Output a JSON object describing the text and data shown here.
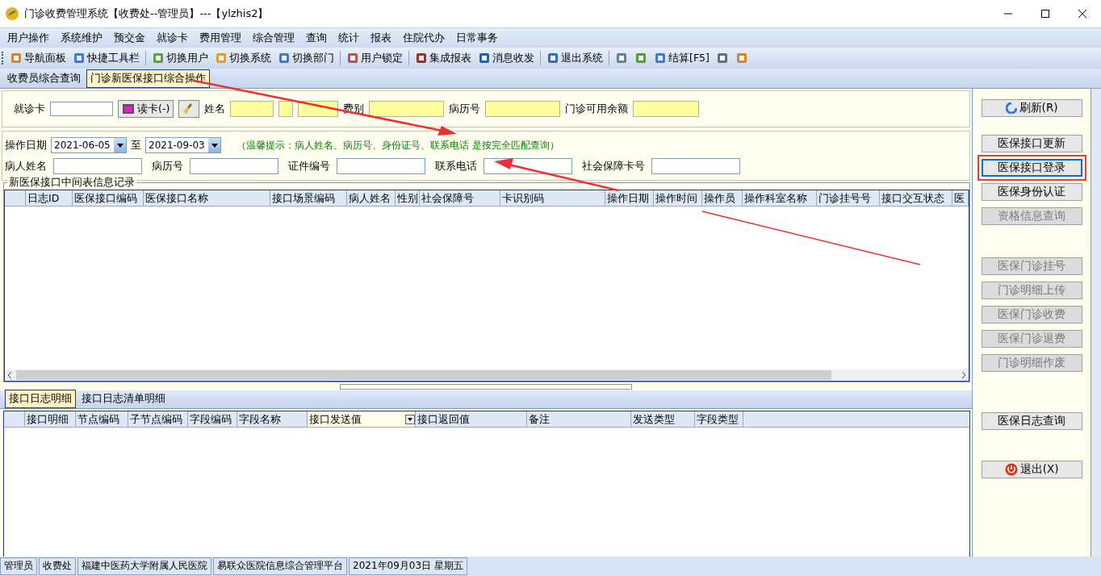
{
  "window": {
    "title": "门诊收费管理系统【收费处--管理员】---【ylzhis2】"
  },
  "menu": [
    "用户操作",
    "系统维护",
    "预交金",
    "就诊卡",
    "费用管理",
    "综合管理",
    "查询",
    "统计",
    "报表",
    "住院代办",
    "日常事务"
  ],
  "toolbar": [
    {
      "kind": "labeled",
      "label": "导航面板"
    },
    {
      "kind": "labeled",
      "label": "快捷工具栏"
    },
    {
      "kind": "separator"
    },
    {
      "kind": "labeled",
      "label": "切换用户"
    },
    {
      "kind": "labeled",
      "label": "切换系统"
    },
    {
      "kind": "labeled",
      "label": "切换部门"
    },
    {
      "kind": "separator"
    },
    {
      "kind": "labeled",
      "label": "用户锁定"
    },
    {
      "kind": "separator"
    },
    {
      "kind": "labeled",
      "label": "集成报表"
    },
    {
      "kind": "labeled",
      "label": "消息收发"
    },
    {
      "kind": "separator"
    },
    {
      "kind": "labeled",
      "label": "退出系统"
    },
    {
      "kind": "separator"
    },
    {
      "kind": "icon"
    },
    {
      "kind": "icon"
    },
    {
      "kind": "labeled",
      "label": "结算[F5]"
    },
    {
      "kind": "icon"
    },
    {
      "kind": "icon"
    }
  ],
  "tabs": [
    {
      "label": "收费员综合查询",
      "selected": false
    },
    {
      "label": "门诊新医保接口综合操作",
      "selected": true
    }
  ],
  "card_panel": {
    "card_label": "就诊卡",
    "read_button": "读卡(-)",
    "fields": [
      {
        "label": "姓名",
        "kind": "split"
      },
      {
        "label": "费别",
        "kind": "single"
      },
      {
        "label": "病历号",
        "kind": "single"
      },
      {
        "label": "门诊可用余额",
        "kind": "short"
      }
    ]
  },
  "filter": {
    "date_label": "操作日期",
    "date_from": "2021-06-05",
    "to_label": "至",
    "date_to": "2021-09-03",
    "hint": "（温馨提示：病人姓名、病历号、身份证号、联系电话 是按完全匹配查询）",
    "fields": [
      "病人姓名",
      "病历号",
      "证件编号",
      "联系电话",
      "社会保障卡号"
    ]
  },
  "log_group": {
    "title": "新医保接口中间表信息记录",
    "columns": [
      "日志ID",
      "医保接口编码",
      "医保接口名称",
      "接口场景编码",
      "病人姓名",
      "性别",
      "社会保障号",
      "卡识别码",
      "操作日期",
      "操作时间",
      "操作员",
      "操作科室名称",
      "门诊挂号号",
      "接口交互状态",
      "医"
    ]
  },
  "detail_tabs": [
    {
      "label": "接口日志明细",
      "selected": true
    },
    {
      "label": "接口日志清单明细",
      "selected": false
    }
  ],
  "detail_columns": [
    {
      "label": "接口明细",
      "kind": "plain"
    },
    {
      "label": "节点编码",
      "kind": "plain"
    },
    {
      "label": "子节点编码",
      "kind": "plain"
    },
    {
      "label": "字段编码",
      "kind": "plain"
    },
    {
      "label": "字段名称",
      "kind": "plain"
    },
    {
      "label": "接口发送值",
      "kind": "dropdown"
    },
    {
      "label": "接口返回值",
      "kind": "plain"
    },
    {
      "label": "备注",
      "kind": "plain"
    },
    {
      "label": "发送类型",
      "kind": "plain"
    },
    {
      "label": "字段类型",
      "kind": "plain"
    }
  ],
  "side_groups": [
    {
      "buttons": [
        {
          "label": "刷新(R)",
          "kind": "refresh",
          "disabled": false,
          "highlighted": false
        }
      ]
    },
    {
      "buttons": [
        {
          "label": "医保接口更新",
          "kind": "plain",
          "disabled": false,
          "highlighted": false
        },
        {
          "label": "医保接口登录",
          "kind": "plain",
          "disabled": false,
          "highlighted": true
        },
        {
          "label": "医保身份认证",
          "kind": "plain",
          "disabled": false,
          "highlighted": false
        },
        {
          "label": "资格信息查询",
          "kind": "plain",
          "disabled": true,
          "highlighted": false
        }
      ]
    },
    {
      "buttons": [
        {
          "label": "医保门诊挂号",
          "kind": "plain",
          "disabled": true,
          "highlighted": false
        },
        {
          "label": "门诊明细上传",
          "kind": "plain",
          "disabled": true,
          "highlighted": false
        },
        {
          "label": "医保门诊收费",
          "kind": "plain",
          "disabled": true,
          "highlighted": false
        },
        {
          "label": "医保门诊退费",
          "kind": "plain",
          "disabled": true,
          "highlighted": false
        },
        {
          "label": "门诊明细作废",
          "kind": "plain",
          "disabled": true,
          "highlighted": false
        }
      ]
    },
    {
      "buttons": [
        {
          "label": "医保日志查询",
          "kind": "plain",
          "disabled": false,
          "highlighted": false
        }
      ]
    },
    {
      "buttons": [
        {
          "label": "退出(X)",
          "kind": "exit",
          "disabled": false,
          "highlighted": false
        }
      ]
    }
  ],
  "status_bar": [
    "管理员",
    "收费处",
    "福建中医药大学附属人民医院",
    "易联众医院信息综合管理平台",
    "2021年09月03日  星期五"
  ]
}
